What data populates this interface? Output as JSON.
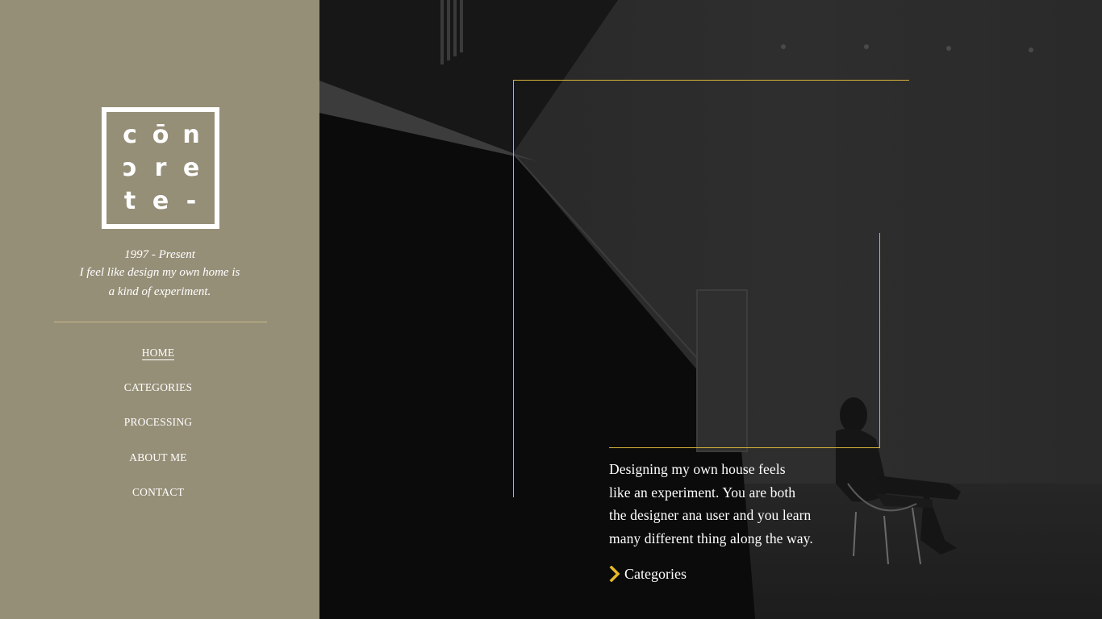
{
  "brand": {
    "logo_letters": [
      "c",
      "ō",
      "n",
      "ɔ",
      "r",
      "e",
      "t",
      "e",
      "-"
    ],
    "logo_text": "concrete"
  },
  "sidebar": {
    "years": "1997 - Present",
    "tagline_line1": "I feel like design my own home is",
    "tagline_line2": "a kind of experiment.",
    "nav": [
      {
        "label": "HOME",
        "active": true
      },
      {
        "label": "CATEGORIES",
        "active": false
      },
      {
        "label": "PROCESSING",
        "active": false
      },
      {
        "label": "ABOUT ME",
        "active": false
      },
      {
        "label": "CONTACT",
        "active": false
      }
    ]
  },
  "hero": {
    "quote_lines": [
      "Designing my own house feels",
      "like an experiment. You are both",
      "the designer ana user and you learn",
      "many different thing along the way."
    ],
    "cta_label": "Categories",
    "cta_icon": "chevron-right-icon"
  },
  "colors": {
    "sidebar_bg": "#968f78",
    "accent": "#d7b53a",
    "text": "#ffffff"
  }
}
